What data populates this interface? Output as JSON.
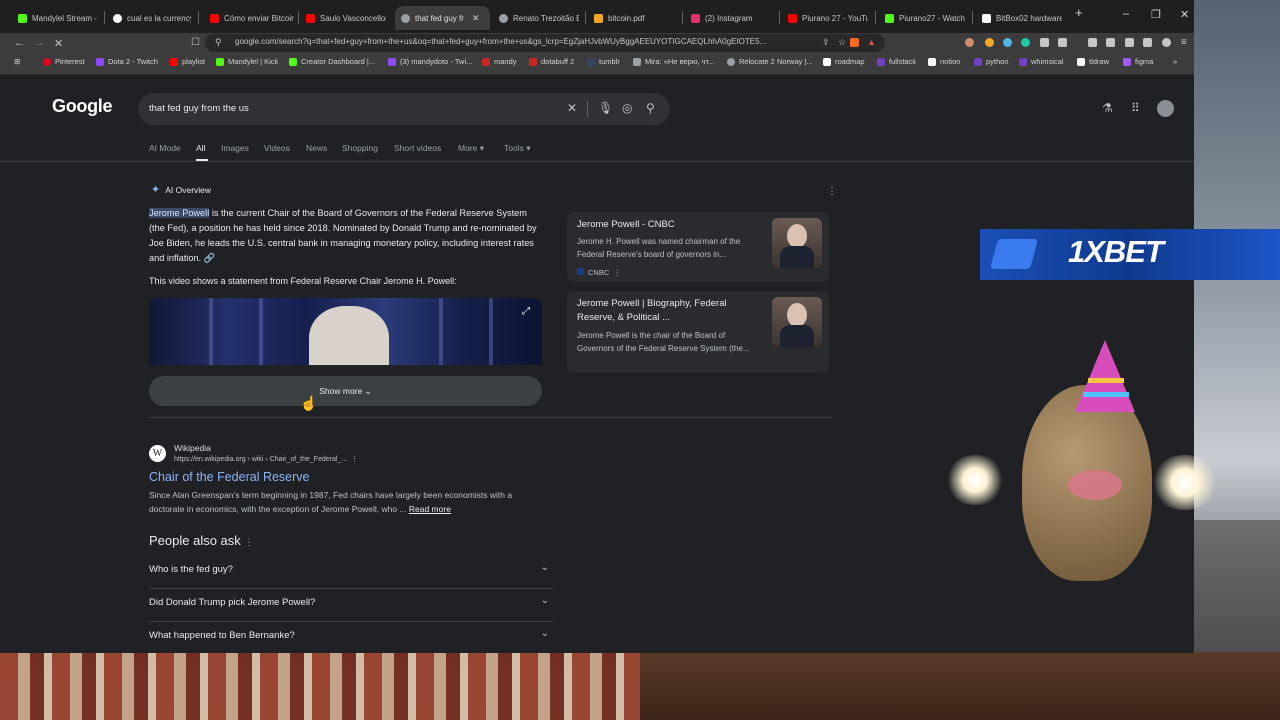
{
  "tabs": [
    {
      "title": "Mandylel Stream - V",
      "color": "#53fc18"
    },
    {
      "title": "cual es la currency c",
      "color": "#ffffff"
    },
    {
      "title": "Cómo enviar Bitcoin",
      "color": "#ff0000"
    },
    {
      "title": "Saulo Vasconcellos",
      "color": "#ff0000"
    },
    {
      "title": "that fed guy fr",
      "color": "#9aa0a6",
      "active": true
    },
    {
      "title": "Renato Trezoitão B",
      "color": "#9aa0a6"
    },
    {
      "title": "bitcoin.pdf",
      "color": "#f5a623"
    },
    {
      "title": "(2) Instagram",
      "color": "#e1306c"
    },
    {
      "title": "Piurano 27 - YouTu",
      "color": "#ff0000"
    },
    {
      "title": "Piurano27 - Watch",
      "color": "#53fc18"
    },
    {
      "title": "BitBox02 hardware",
      "color": "#ffffff"
    }
  ],
  "address_bar": {
    "url": "google.com/search?q=that+fed+guy+from+the+us&oq=that+fed+guy+from+the+us&gs_lcrp=EgZjaHJvbWUyBggAEEUYOTIGCAEQLhhA0gEIOTE5..."
  },
  "bookmarks": [
    {
      "label": "Pinterest",
      "color": "#e60023"
    },
    {
      "label": "Dota 2 - Twitch",
      "color": "#9146ff"
    },
    {
      "label": "playlist",
      "color": "#ff0000"
    },
    {
      "label": "Mandylel | Kick",
      "color": "#53fc18"
    },
    {
      "label": "Creator Dashboard |...",
      "color": "#53fc18"
    },
    {
      "label": "(3) mandydoto - Twi...",
      "color": "#9146ff"
    },
    {
      "label": "mandy",
      "color": "#c62828"
    },
    {
      "label": "dotabuff 2",
      "color": "#c62828"
    },
    {
      "label": "tumblr",
      "color": "#36465d"
    },
    {
      "label": "Mira: «Не верю, чт...",
      "color": "#9aa0a6"
    },
    {
      "label": "Relocate 2 Norway |...",
      "color": "#9aa0a6"
    },
    {
      "label": "roadmap",
      "color": "#ffffff"
    },
    {
      "label": "fullstack",
      "color": "#6f42c1"
    },
    {
      "label": "notion",
      "color": "#ffffff"
    },
    {
      "label": "python",
      "color": "#6f42c1"
    },
    {
      "label": "whimsical",
      "color": "#6f42c1"
    },
    {
      "label": "tldraw",
      "color": "#ffffff"
    },
    {
      "label": "figma",
      "color": "#a259ff"
    }
  ],
  "google": {
    "logo": "Google",
    "query": "that fed guy from the us",
    "tabs": [
      "AI Mode",
      "All",
      "Images",
      "Videos",
      "News",
      "Shopping",
      "Short videos",
      "More",
      "Tools"
    ],
    "ai_overview": {
      "heading": "AI Overview",
      "highlight": "Jerome Powell",
      "text": " is the current Chair of the Board of Governors of the Federal Reserve System (the Fed), a position he has held since 2018. Nominated by Donald Trump and re-nominated by Joe Biden, he leads the U.S. central bank in managing monetary policy, including interest rates and inflation.",
      "video_intro": "This video shows a statement from Federal Reserve Chair Jerome H. Powell:",
      "show_more": "Show more"
    },
    "cards": [
      {
        "title": "Jerome Powell - CNBC",
        "snippet": "Jerome H. Powell was named chairman of the Federal Reserve's board of governors in...",
        "source": "CNBC"
      },
      {
        "title": "Jerome Powell | Biography, Federal Reserve, & Political ...",
        "snippet": "Jerome Powell is the chair of the Board of Governors of the Federal Reserve System (the..."
      }
    ],
    "result": {
      "site": "Wikipedia",
      "url": "https://en.wikipedia.org › wiki › Chair_of_the_Federal_...",
      "title": "Chair of the Federal Reserve",
      "snippet": "Since Alan Greenspan's term beginning in 1987, Fed chairs have largely been economists with a doctorate in economics, with the exception of Jerome Powell, who ...",
      "read_more": "Read more"
    },
    "people_also_ask": {
      "heading": "People also ask",
      "questions": [
        "Who is the fed guy?",
        "Did Donald Trump pick Jerome Powell?",
        "What happened to Ben Bernanke?"
      ]
    }
  },
  "overlay": {
    "ad_text": "1XBET"
  }
}
